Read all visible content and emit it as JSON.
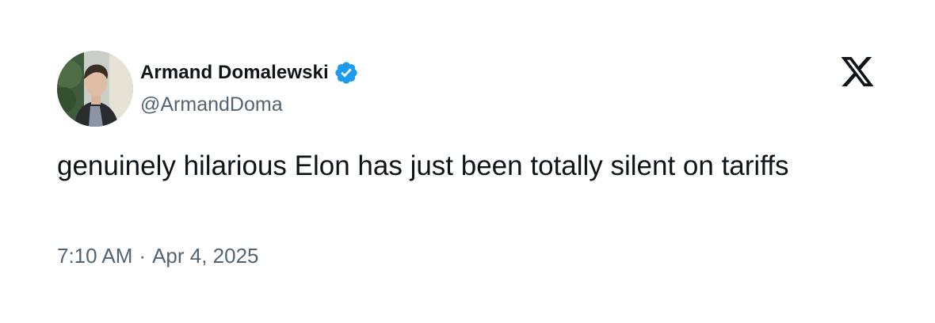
{
  "author": {
    "display_name": "Armand Domalewski",
    "handle": "@ArmandDoma",
    "verified": true,
    "avatar_icon": "profile-photo"
  },
  "tweet": {
    "text": "genuinely hilarious Elon has just been totally silent on tariffs",
    "time": "7:10 AM",
    "separator": "·",
    "date": "Apr 4, 2025"
  },
  "branding": {
    "logo_icon": "x-logo-icon"
  },
  "colors": {
    "text_primary": "#0f1419",
    "text_secondary": "#536471",
    "verified_blue": "#1d9bf0",
    "background": "#ffffff"
  }
}
